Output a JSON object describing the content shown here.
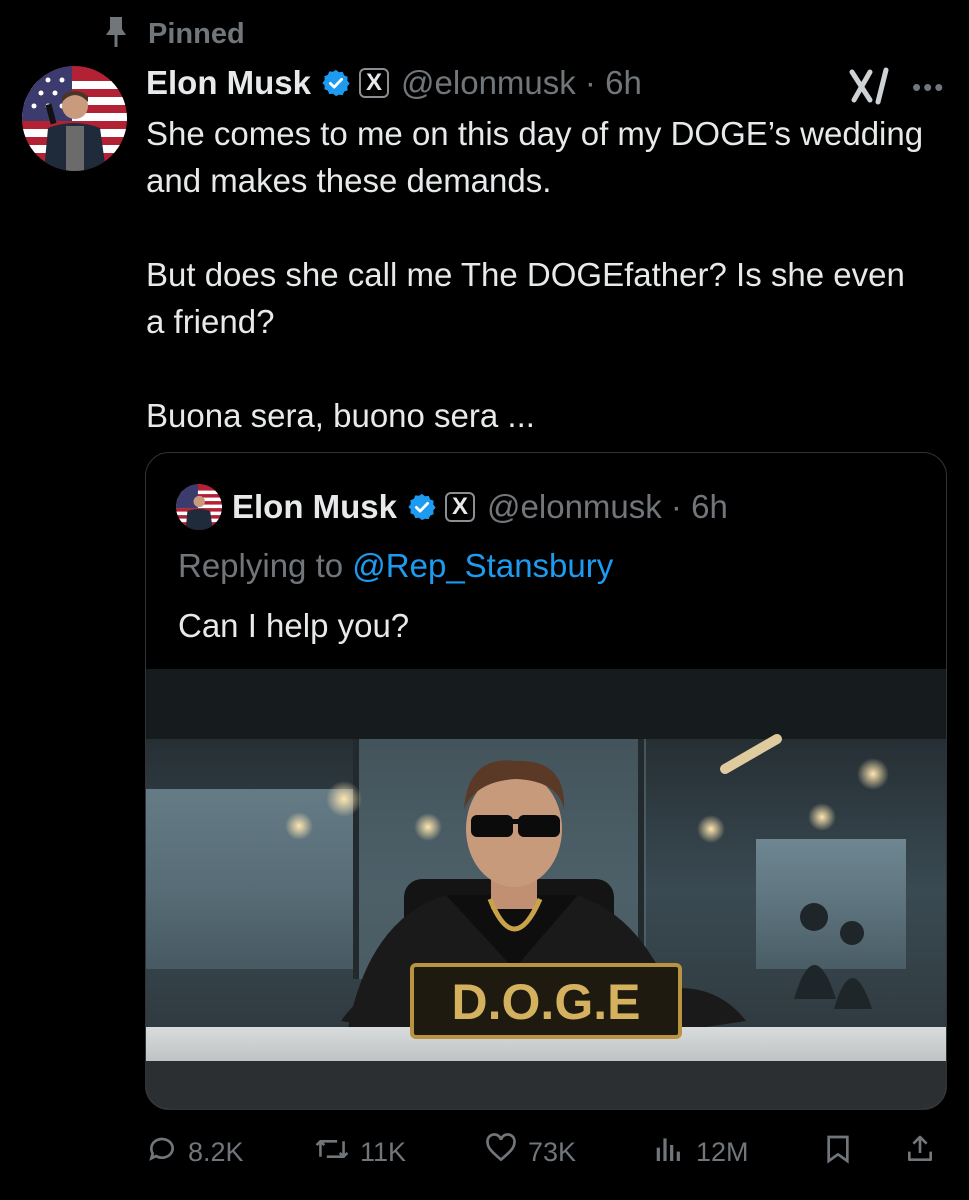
{
  "pinned": {
    "label": "Pinned"
  },
  "tweet": {
    "author_name": "Elon Musk",
    "x_badge": "X",
    "handle_time": "@elonmusk · 6h",
    "paragraphs": [
      "She comes to me on this day of my DOGE’s wedding and makes these demands.",
      "But does she call me The DOGEfather? Is she even a friend?",
      "Buona sera, buono sera ..."
    ]
  },
  "quote": {
    "author_name": "Elon Musk",
    "x_badge": "X",
    "handle_time": "@elonmusk · 6h",
    "replying_prefix": "Replying to",
    "replying_to": "@Rep_Stansbury",
    "text": "Can I help you?",
    "image_sign": "D.O.G.E"
  },
  "actions": {
    "replies": "8.2K",
    "reposts": "11K",
    "likes": "73K",
    "views": "12M"
  },
  "colors": {
    "background": "#000000",
    "text": "#e7e9ea",
    "muted": "#71767b",
    "accent": "#1d9bf0",
    "border": "#2f3336"
  },
  "icons": [
    "pin-icon",
    "verified-icon",
    "x-badge-icon",
    "grok-icon",
    "more-icon",
    "reply-icon",
    "repost-icon",
    "like-icon",
    "views-icon",
    "bookmark-icon",
    "share-icon"
  ]
}
